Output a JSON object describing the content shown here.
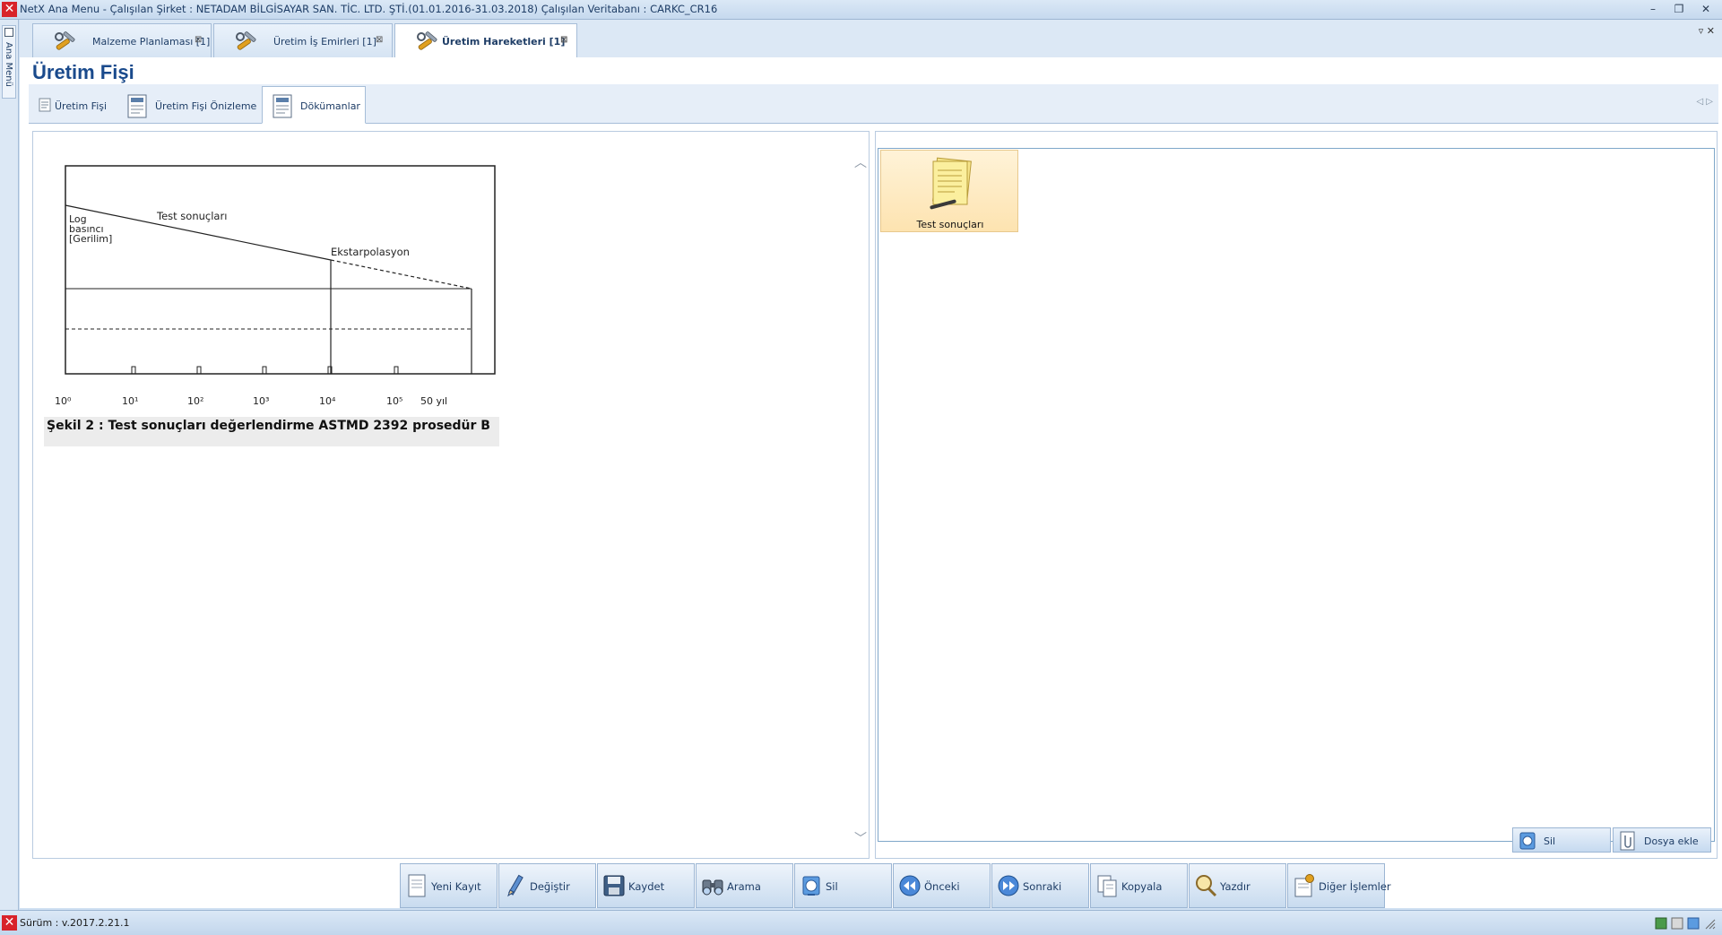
{
  "window": {
    "title": "NetX Ana Menu - Çalışılan Şirket : NETADAM BİLGİSAYAR SAN. TİC. LTD. ŞTİ.(01.01.2016-31.03.2018) Çalışılan Veritabanı : CARKC_CR16",
    "minimize": "–",
    "restore": "❐",
    "close": "✕"
  },
  "side": {
    "label": "Ana Menü"
  },
  "doc_tabs": [
    {
      "label": "Malzeme Planlaması [1]",
      "active": false
    },
    {
      "label": "Üretim İş Emirleri [1]",
      "active": false
    },
    {
      "label": "Üretim Hareketleri [1]",
      "active": true
    }
  ],
  "tab_close": "⊠",
  "tab_menu": "▿  ✕",
  "page": {
    "title": "Üretim Fişi"
  },
  "sub_tabs": [
    {
      "label": "Üretim Fişi",
      "active": false
    },
    {
      "label": "Üretim Fişi Önizleme",
      "active": false
    },
    {
      "label": "Dökümanlar",
      "active": true
    }
  ],
  "sub_nav": "◁  ▷",
  "left_panel": {
    "scroll_up": "︿",
    "scroll_down": "﹀"
  },
  "figure": {
    "y_label_lines": [
      "Log",
      "basıncı",
      "[Gerilim]"
    ],
    "label_test": "Test sonuçları",
    "label_extrap": "Ekstarpolasyon",
    "x_ticks": [
      "10⁰",
      "10¹",
      "10²",
      "10³",
      "10⁴",
      "10⁵",
      "50 yıl"
    ],
    "caption": "Şekil 2 : Test sonuçları değerlendirme ASTMD 2392 prosedür B"
  },
  "documents": [
    {
      "name": "Test sonuçları",
      "icon": "document-note-icon"
    }
  ],
  "doc_buttons": {
    "delete": "Sil",
    "add_file": "Dosya ekle"
  },
  "toolbar": {
    "new": "Yeni Kayıt",
    "edit": "Değiştir",
    "save": "Kaydet",
    "search": "Arama",
    "delete": "Sil",
    "prev": "Önceki",
    "next": "Sonraki",
    "copy": "Kopyala",
    "print": "Yazdır",
    "other": "Diğer İşlemler"
  },
  "status": {
    "version": "Sürüm : v.2017.2.21.1"
  },
  "colors": {
    "accent": "#1a4a8c",
    "chrome": "#cfe0f2",
    "brand_red": "#d8232a",
    "tile": "#fde3b0"
  }
}
